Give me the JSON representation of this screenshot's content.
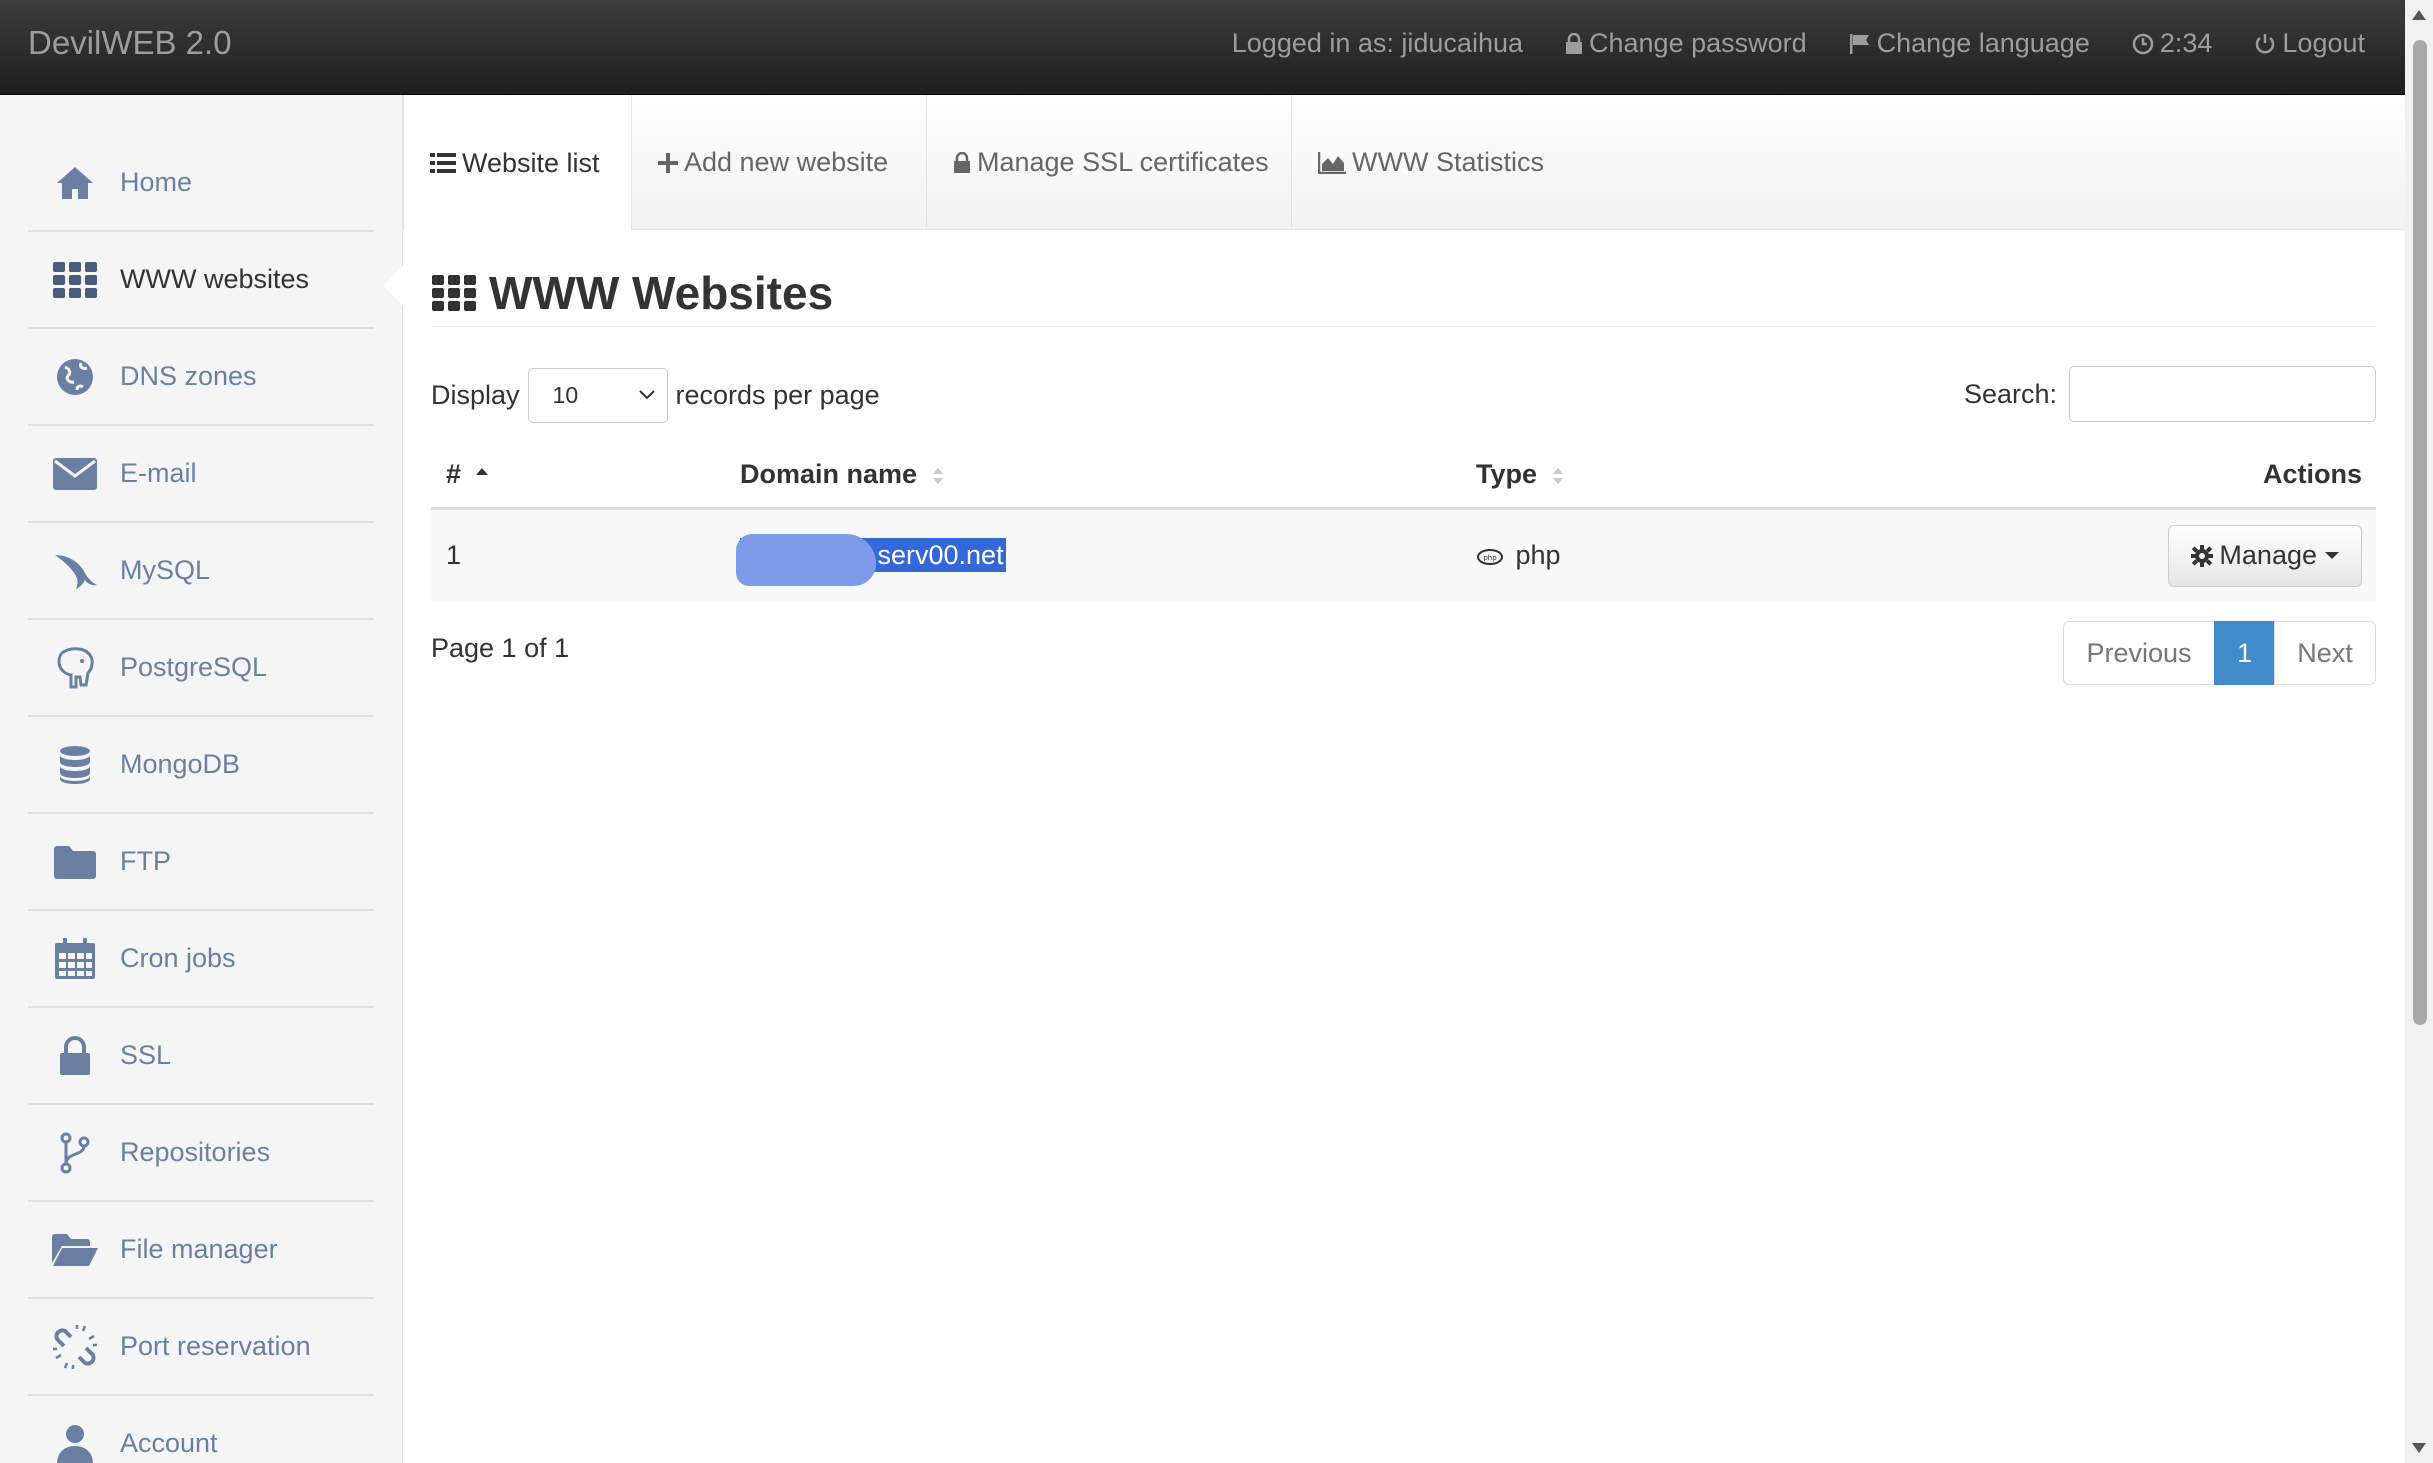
{
  "navbar": {
    "brand": "DevilWEB 2.0",
    "logged_in": "Logged in as: jiducaihua",
    "change_password": "Change password",
    "change_language": "Change language",
    "session_time": "2:34",
    "logout": "Logout"
  },
  "sidebar": {
    "items": [
      {
        "label": "Home",
        "icon": "home-icon"
      },
      {
        "label": "WWW websites",
        "icon": "grid-icon"
      },
      {
        "label": "DNS zones",
        "icon": "globe-icon"
      },
      {
        "label": "E-mail",
        "icon": "envelope-icon"
      },
      {
        "label": "MySQL",
        "icon": "dolphin-icon"
      },
      {
        "label": "PostgreSQL",
        "icon": "elephant-icon"
      },
      {
        "label": "MongoDB",
        "icon": "database-icon"
      },
      {
        "label": "FTP",
        "icon": "folder-icon"
      },
      {
        "label": "Cron jobs",
        "icon": "calendar-icon"
      },
      {
        "label": "SSL",
        "icon": "lock-icon"
      },
      {
        "label": "Repositories",
        "icon": "branch-icon"
      },
      {
        "label": "File manager",
        "icon": "folder-open-icon"
      },
      {
        "label": "Port reservation",
        "icon": "unlink-icon"
      },
      {
        "label": "Account",
        "icon": "user-icon"
      }
    ]
  },
  "tabs": {
    "website_list": "Website list",
    "add_new": "Add new website",
    "manage_ssl": "Manage SSL certificates",
    "statistics": "WWW Statistics"
  },
  "main": {
    "title": "WWW Websites",
    "display_label": "Display",
    "per_page_value": "10",
    "per_page_suffix": "records per page",
    "search_label": "Search:",
    "search_value": "",
    "columns": {
      "num": "#",
      "domain": "Domain name",
      "type": "Type",
      "actions": "Actions"
    },
    "rows": [
      {
        "num": "1",
        "domain": ".serv00.net",
        "type": "php",
        "action": "Manage"
      }
    ],
    "page_info": "Page 1 of 1",
    "pagination": {
      "previous": "Previous",
      "current": "1",
      "next": "Next"
    }
  },
  "colors": {
    "navbar_bg": "#222222",
    "sidebar_text": "#6b7fa3",
    "link_blue": "#428bca",
    "selection": "#3468d8"
  }
}
